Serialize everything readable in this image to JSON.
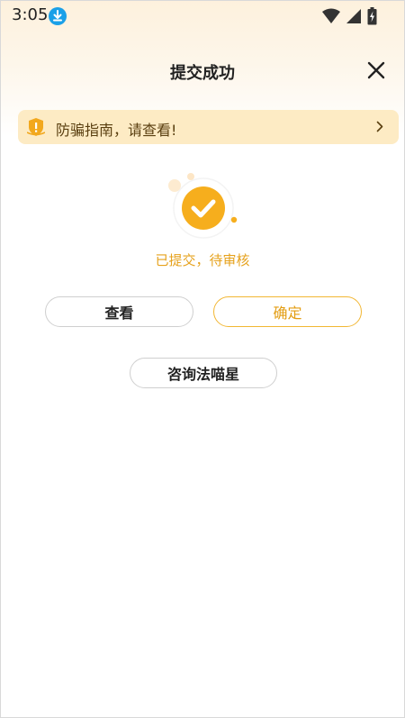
{
  "status_bar": {
    "time": "3:05",
    "icons": [
      "download-icon",
      "wifi-icon",
      "signal-icon",
      "battery-icon"
    ]
  },
  "header": {
    "title": "提交成功",
    "close_icon": "close-icon"
  },
  "notice": {
    "text": "防骗指南，请查看!",
    "icon": "shield-icon",
    "chevron": "chevron-right-icon"
  },
  "result": {
    "status_text": "已提交，待审核",
    "icon": "check-circle-icon"
  },
  "buttons": {
    "view": "查看",
    "confirm": "确定",
    "consult": "咨询法喵星"
  },
  "colors": {
    "accent": "#f6ae1d",
    "notice_bg": "#fdebc4",
    "status_text": "#e6a21d",
    "download_badge": "#1aa0e8"
  }
}
